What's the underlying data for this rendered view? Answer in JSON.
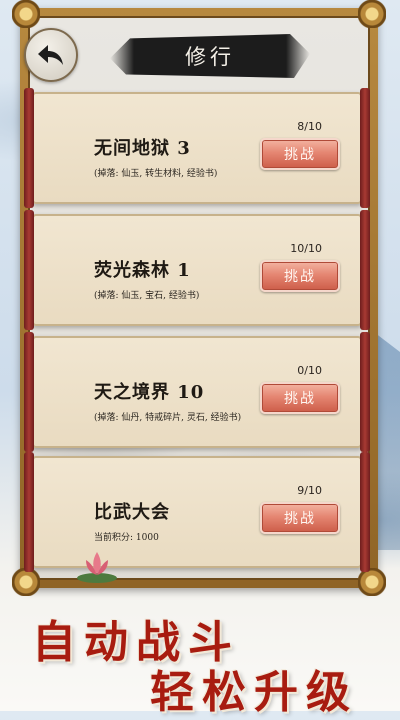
{
  "header": {
    "title": "修行"
  },
  "levels": [
    {
      "name": "无间地狱 3",
      "progress": "8/10",
      "drops": "(掉落: 仙玉, 转生材料, 经验书)",
      "button": "挑战"
    },
    {
      "name": "荧光森林 1",
      "progress": "10/10",
      "drops": "(掉落: 仙玉, 宝石, 经验书)",
      "button": "挑战"
    },
    {
      "name": "天之境界 10",
      "progress": "0/10",
      "drops": "(掉落: 仙丹, 特戒碎片, 灵石, 经验书)",
      "button": "挑战"
    },
    {
      "name": "比武大会",
      "progress": "9/10",
      "drops": "当前积分: 1000",
      "button": "挑战"
    }
  ],
  "slogan": {
    "line1": "自动战斗",
    "line2": "轻松升级"
  },
  "colors": {
    "accent": "#cd5d49",
    "slogan": "#a81c10",
    "frame": "#b7893f"
  },
  "icons": {
    "back": "back-arrow-icon",
    "decoration": "lotus-icon"
  }
}
